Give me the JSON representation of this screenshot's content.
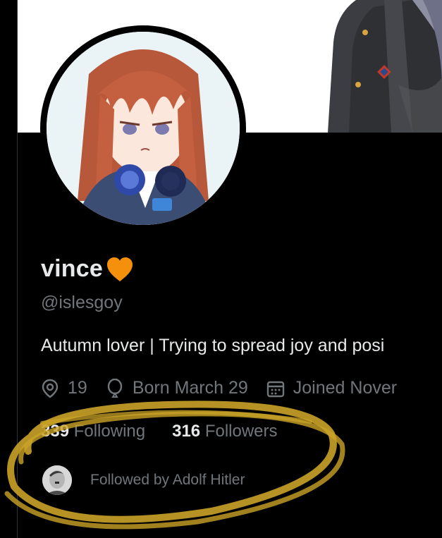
{
  "profile": {
    "display_name": "vince",
    "handle": "@islesgoy",
    "bio": "Autumn lover | Trying to spread joy and posi",
    "location": "19",
    "birthday": "Born March 29",
    "joined": "Joined Nover",
    "following_count": "339",
    "following_label": "Following",
    "followers_count": "316",
    "followers_label": "Followers",
    "followed_by": "Followed by Adolf Hitler"
  },
  "icons": {
    "heart": "orange-heart-icon",
    "location": "location-pin-icon",
    "birthday": "balloon-icon",
    "joined": "calendar-icon"
  },
  "colors": {
    "background": "#000000",
    "primary_text": "#e7e9ea",
    "secondary_text": "#71767b",
    "heart": "#f4900c",
    "scribble": "#c9a227",
    "banner": "#ffffff"
  }
}
